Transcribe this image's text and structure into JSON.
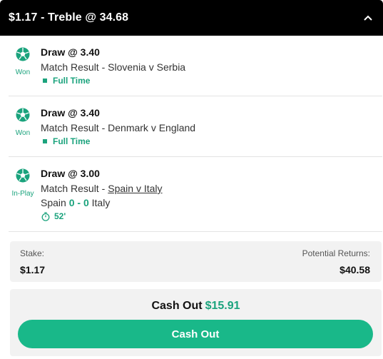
{
  "header": {
    "title": "$1.17 - Treble @ 34.68",
    "collapse_icon": "chevron-up-icon"
  },
  "selections": [
    {
      "status": "Won",
      "title": "Draw @ 3.40",
      "market": "Match Result - Slovenia v Serbia",
      "time_status": "Full Time",
      "icon": "soccer-ball-icon"
    },
    {
      "status": "Won",
      "title": "Draw @ 3.40",
      "market": "Match Result - Denmark v England",
      "time_status": "Full Time",
      "icon": "soccer-ball-icon"
    },
    {
      "status": "In-Play",
      "title": "Draw @ 3.00",
      "market_prefix": "Match Result -",
      "market_link": "Spain v Italy",
      "score": {
        "home_team": "Spain",
        "home_score": "0",
        "separator": "-",
        "away_score": "0",
        "away_team": "Italy"
      },
      "clock": "52'",
      "icon": "soccer-ball-icon"
    }
  ],
  "stake": {
    "label": "Stake:",
    "value": "$1.17"
  },
  "returns": {
    "label": "Potential Returns:",
    "value": "$40.58"
  },
  "cashout": {
    "label": "Cash Out",
    "amount": "$15.91",
    "button_label": "Cash Out"
  },
  "colors": {
    "accent_green": "#1ba37d",
    "button_green": "#19b889",
    "header_bg": "#000000"
  }
}
